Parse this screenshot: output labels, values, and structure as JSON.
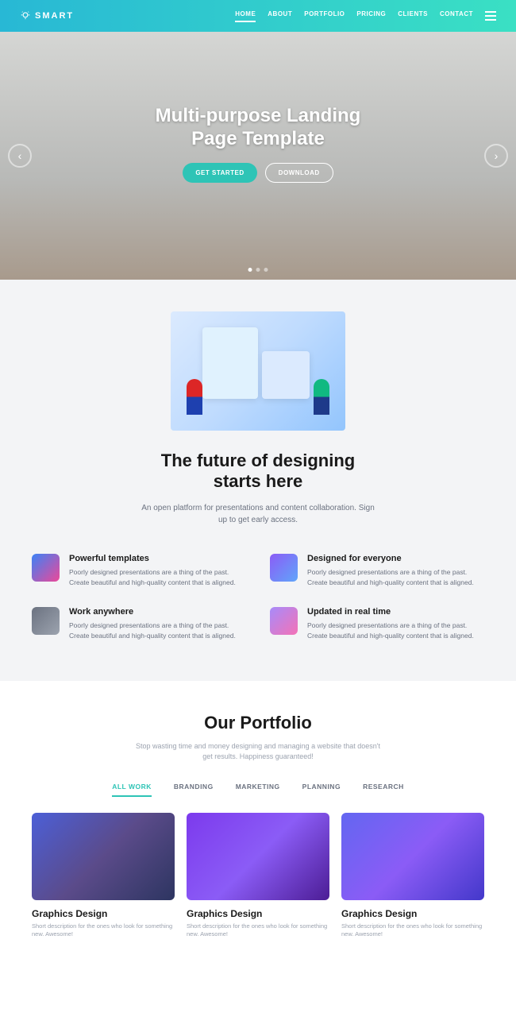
{
  "brand": "SMART",
  "nav": [
    "HOME",
    "ABOUT",
    "PORTFOLIO",
    "PRICING",
    "CLIENTS",
    "CONTACT"
  ],
  "hero": {
    "title1": "Multi-purpose Landing",
    "title2": "Page Template",
    "btn1": "GET STARTED",
    "btn2": "DOWNLOAD"
  },
  "features": {
    "title1": "The future of designing",
    "title2": "starts here",
    "subtitle": "An open platform for presentations and content collaboration. Sign up to get early access.",
    "items": [
      {
        "title": "Powerful templates",
        "desc": "Poorly designed presentations are a thing of the past. Create beautiful and high-quality content that is aligned."
      },
      {
        "title": "Designed for everyone",
        "desc": "Poorly designed presentations are a thing of the past. Create beautiful and high-quality content that is aligned."
      },
      {
        "title": "Work anywhere",
        "desc": "Poorly designed presentations are a thing of the past. Create beautiful and high-quality content that is aligned."
      },
      {
        "title": "Updated in real time",
        "desc": "Poorly designed presentations are a thing of the past. Create beautiful and high-quality content that is aligned."
      }
    ]
  },
  "portfolio": {
    "title": "Our Portfolio",
    "subtitle": "Stop wasting time and money designing and managing a website that doesn't get results. Happiness guaranteed!",
    "tabs": [
      "ALL WORK",
      "BRANDING",
      "MARKETING",
      "PLANNING",
      "RESEARCH"
    ],
    "items": [
      {
        "title": "Graphics Design",
        "desc": "Short description for the ones who look for something new. Awesome!"
      },
      {
        "title": "Graphics Design",
        "desc": "Short description for the ones who look for something new. Awesome!"
      },
      {
        "title": "Graphics Design",
        "desc": "Short description for the ones who look for something new. Awesome!"
      }
    ]
  }
}
